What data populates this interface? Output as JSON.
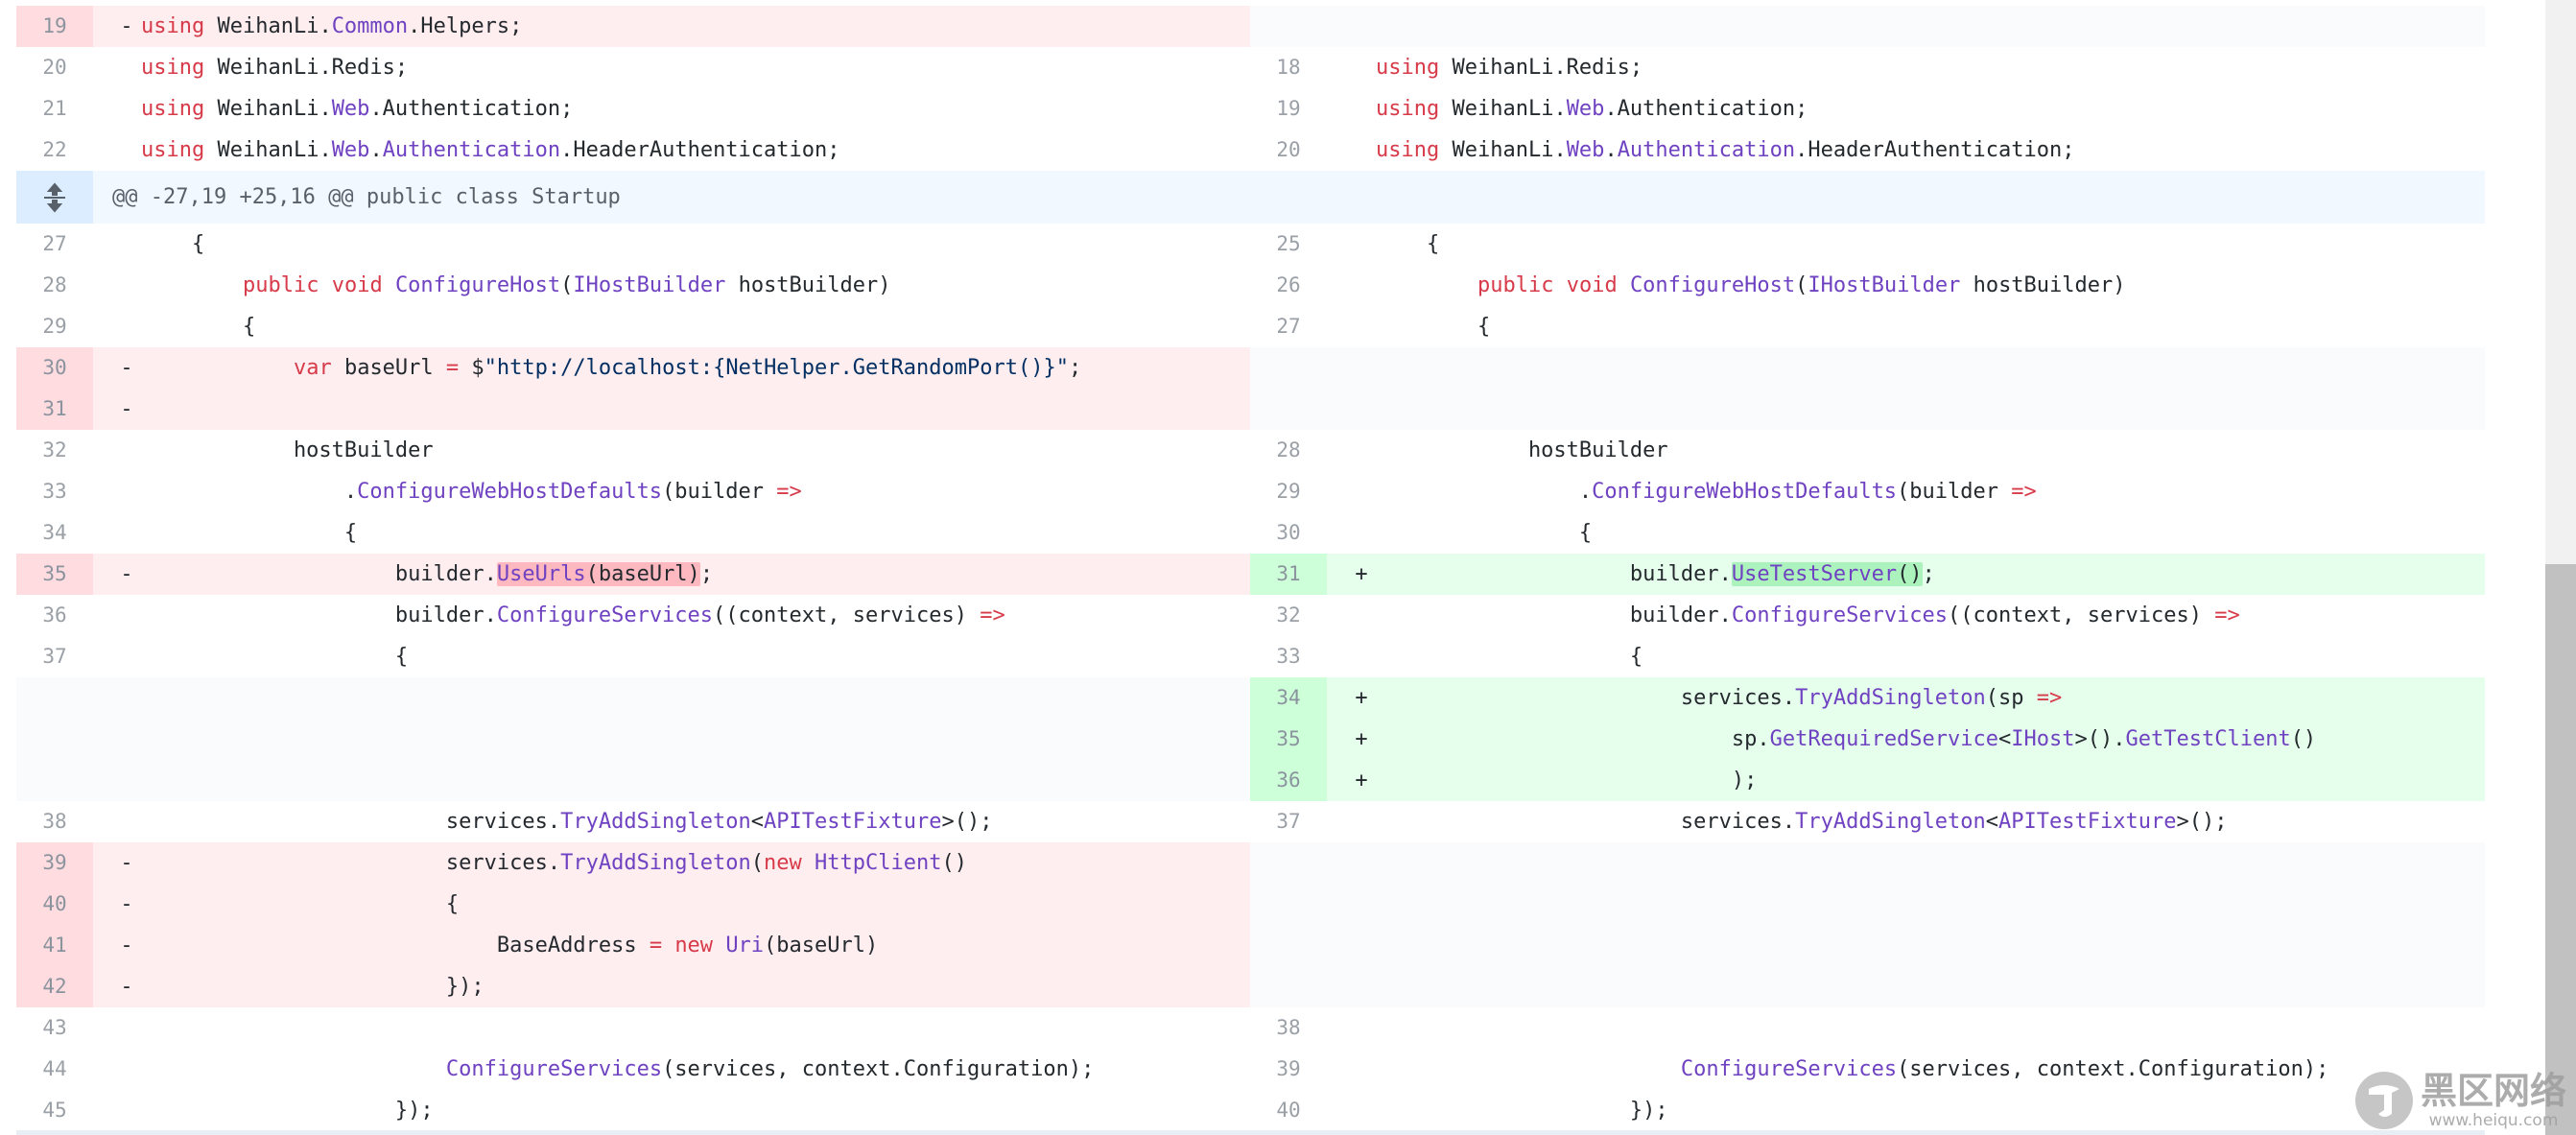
{
  "hunk": {
    "header": "@@ -27,19 +25,16 @@ public class Startup"
  },
  "colors": {
    "deletion_bg": "#ffeef0",
    "addition_bg": "#e6ffed",
    "hunk_bg": "#f1f8ff",
    "keyword": "#d73a49",
    "type": "#6f42c1"
  },
  "icons": {
    "expand": "expand-arrows-icon",
    "logo": "watermark-logo-icon"
  },
  "rows": [
    {
      "type": "split",
      "lnL": "19",
      "sL": "-",
      "codeL": "using WeihanLi.Common.Helpers;",
      "bgL": "del",
      "lnR": "",
      "sR": "",
      "codeR": "",
      "bgR": "empty"
    },
    {
      "type": "split",
      "lnL": "20",
      "sL": "",
      "codeL": "using WeihanLi.Redis;",
      "bgL": "ctx",
      "lnR": "18",
      "sR": "",
      "codeR": "using WeihanLi.Redis;",
      "bgR": "ctx"
    },
    {
      "type": "split",
      "lnL": "21",
      "sL": "",
      "codeL": "using WeihanLi.Web.Authentication;",
      "bgL": "ctx",
      "lnR": "19",
      "sR": "",
      "codeR": "using WeihanLi.Web.Authentication;",
      "bgR": "ctx"
    },
    {
      "type": "split",
      "lnL": "22",
      "sL": "",
      "codeL": "using WeihanLi.Web.Authentication.HeaderAuthentication;",
      "bgL": "ctx",
      "lnR": "20",
      "sR": "",
      "codeR": "using WeihanLi.Web.Authentication.HeaderAuthentication;",
      "bgR": "ctx"
    },
    {
      "type": "hunk"
    },
    {
      "type": "split",
      "lnL": "27",
      "sL": "",
      "codeL": "    {",
      "bgL": "ctx",
      "lnR": "25",
      "sR": "",
      "codeR": "    {",
      "bgR": "ctx"
    },
    {
      "type": "split",
      "lnL": "28",
      "sL": "",
      "codeL": "        public void ConfigureHost(IHostBuilder hostBuilder)",
      "bgL": "ctx",
      "lnR": "26",
      "sR": "",
      "codeR": "        public void ConfigureHost(IHostBuilder hostBuilder)",
      "bgR": "ctx"
    },
    {
      "type": "split",
      "lnL": "29",
      "sL": "",
      "codeL": "        {",
      "bgL": "ctx",
      "lnR": "27",
      "sR": "",
      "codeR": "        {",
      "bgR": "ctx"
    },
    {
      "type": "split",
      "lnL": "30",
      "sL": "-",
      "codeL": "            var baseUrl = $\"http://localhost:{NetHelper.GetRandomPort()}\";",
      "bgL": "del",
      "lnR": "",
      "sR": "",
      "codeR": "",
      "bgR": "empty"
    },
    {
      "type": "split",
      "lnL": "31",
      "sL": "-",
      "codeL": "",
      "bgL": "del",
      "lnR": "",
      "sR": "",
      "codeR": "",
      "bgR": "empty"
    },
    {
      "type": "split",
      "lnL": "32",
      "sL": "",
      "codeL": "            hostBuilder",
      "bgL": "ctx",
      "lnR": "28",
      "sR": "",
      "codeR": "            hostBuilder",
      "bgR": "ctx"
    },
    {
      "type": "split",
      "lnL": "33",
      "sL": "",
      "codeL": "                .ConfigureWebHostDefaults(builder =>",
      "bgL": "ctx",
      "lnR": "29",
      "sR": "",
      "codeR": "                .ConfigureWebHostDefaults(builder =>",
      "bgR": "ctx"
    },
    {
      "type": "split",
      "lnL": "34",
      "sL": "",
      "codeL": "                {",
      "bgL": "ctx",
      "lnR": "30",
      "sR": "",
      "codeR": "                {",
      "bgR": "ctx"
    },
    {
      "type": "split",
      "lnL": "35",
      "sL": "-",
      "codeL": "                    builder.UseUrls(baseUrl);",
      "bgL": "del",
      "lnR": "31",
      "sR": "+",
      "codeR": "                    builder.UseTestServer();",
      "bgR": "add"
    },
    {
      "type": "split",
      "lnL": "36",
      "sL": "",
      "codeL": "                    builder.ConfigureServices((context, services) =>",
      "bgL": "ctx",
      "lnR": "32",
      "sR": "",
      "codeR": "                    builder.ConfigureServices((context, services) =>",
      "bgR": "ctx"
    },
    {
      "type": "split",
      "lnL": "37",
      "sL": "",
      "codeL": "                    {",
      "bgL": "ctx",
      "lnR": "33",
      "sR": "",
      "codeR": "                    {",
      "bgR": "ctx"
    },
    {
      "type": "split",
      "lnL": "",
      "sL": "",
      "codeL": "",
      "bgL": "empty",
      "lnR": "34",
      "sR": "+",
      "codeR": "                        services.TryAddSingleton(sp =>",
      "bgR": "add"
    },
    {
      "type": "split",
      "lnL": "",
      "sL": "",
      "codeL": "",
      "bgL": "empty",
      "lnR": "35",
      "sR": "+",
      "codeR": "                            sp.GetRequiredService<IHost>().GetTestClient()",
      "bgR": "add"
    },
    {
      "type": "split",
      "lnL": "",
      "sL": "",
      "codeL": "",
      "bgL": "empty",
      "lnR": "36",
      "sR": "+",
      "codeR": "                            );",
      "bgR": "add"
    },
    {
      "type": "split",
      "lnL": "38",
      "sL": "",
      "codeL": "                        services.TryAddSingleton<APITestFixture>();",
      "bgL": "ctx",
      "lnR": "37",
      "sR": "",
      "codeR": "                        services.TryAddSingleton<APITestFixture>();",
      "bgR": "ctx"
    },
    {
      "type": "split",
      "lnL": "39",
      "sL": "-",
      "codeL": "                        services.TryAddSingleton(new HttpClient()",
      "bgL": "del",
      "lnR": "",
      "sR": "",
      "codeR": "",
      "bgR": "empty"
    },
    {
      "type": "split",
      "lnL": "40",
      "sL": "-",
      "codeL": "                        {",
      "bgL": "del",
      "lnR": "",
      "sR": "",
      "codeR": "",
      "bgR": "empty"
    },
    {
      "type": "split",
      "lnL": "41",
      "sL": "-",
      "codeL": "                            BaseAddress = new Uri(baseUrl)",
      "bgL": "del",
      "lnR": "",
      "sR": "",
      "codeR": "",
      "bgR": "empty"
    },
    {
      "type": "split",
      "lnL": "42",
      "sL": "-",
      "codeL": "                        });",
      "bgL": "del",
      "lnR": "",
      "sR": "",
      "codeR": "",
      "bgR": "empty"
    },
    {
      "type": "split",
      "lnL": "43",
      "sL": "",
      "codeL": "",
      "bgL": "ctx",
      "lnR": "38",
      "sR": "",
      "codeR": "",
      "bgR": "ctx"
    },
    {
      "type": "split",
      "lnL": "44",
      "sL": "",
      "codeL": "                        ConfigureServices(services, context.Configuration);",
      "bgL": "ctx",
      "lnR": "39",
      "sR": "",
      "codeR": "                        ConfigureServices(services, context.Configuration);",
      "bgR": "ctx"
    },
    {
      "type": "split",
      "lnL": "45",
      "sL": "",
      "codeL": "                    });",
      "bgL": "ctx",
      "lnR": "40",
      "sR": "",
      "codeR": "                    });",
      "bgR": "ctx"
    }
  ],
  "watermark": {
    "title": "黑区网络",
    "url": "www.heiqu.com"
  }
}
